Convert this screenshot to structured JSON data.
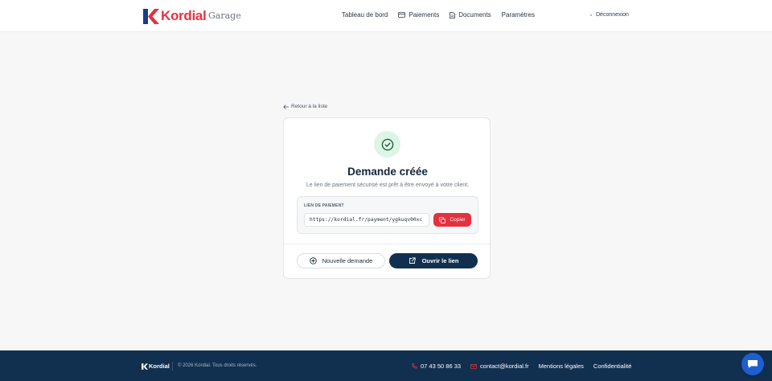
{
  "header": {
    "brand_name": "Kordial",
    "brand_sub": "Garage",
    "nav": [
      {
        "label": "Tableau de bord",
        "icon": null
      },
      {
        "label": "Paiements",
        "icon": "card-icon"
      },
      {
        "label": "Documents",
        "icon": "document-icon"
      },
      {
        "label": "Paramètres",
        "icon": null
      }
    ],
    "logout_label": "Déconnexion"
  },
  "back_link": "Retour à la liste",
  "card": {
    "title": "Demande créée",
    "subtitle": "Le lien de paiement sécurisé est prêt à être envoyé à votre client.",
    "link_label": "LIEN DE PAIEMENT",
    "link_value": "https://kordial.fr/payment/ygkuqv00xc",
    "copy_label": "Copier",
    "new_request_label": "Nouvelle demande",
    "open_link_label": "Ouvrir le lien"
  },
  "footer": {
    "brand_name": "Kordial",
    "copyright": "© 2026 Kordial. Tous droits réservés.",
    "phone": "07 43 50 86 33",
    "email": "contact@kordial.fr",
    "legal": "Mentions légales",
    "privacy": "Confidentialité"
  },
  "colors": {
    "brand_red": "#e4313f",
    "navy": "#11304f",
    "success_bg": "#dcf5e4",
    "success": "#1e7a45",
    "chat_blue": "#1d5fd1"
  }
}
